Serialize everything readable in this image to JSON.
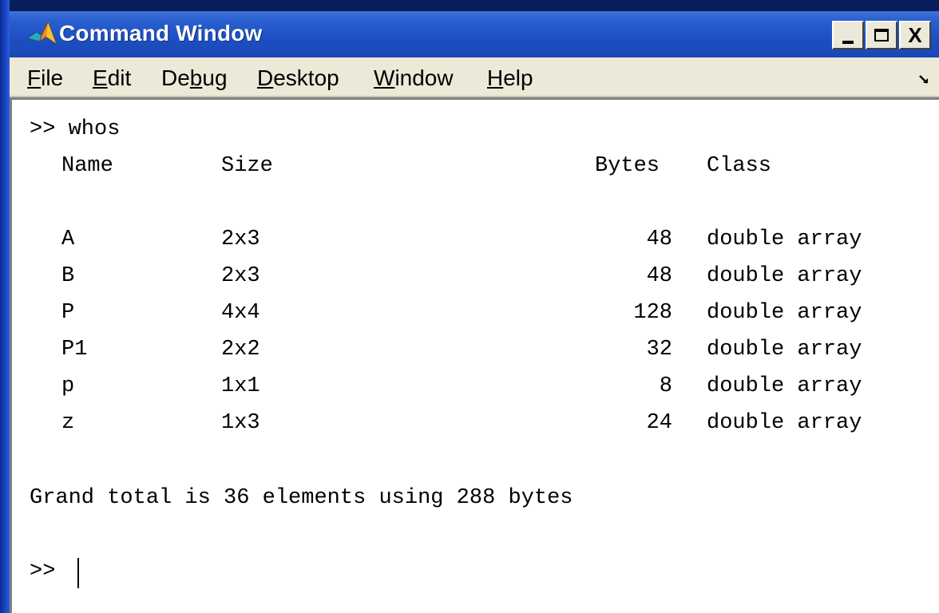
{
  "window": {
    "title": "Command Window",
    "minimize_icon": "minimize-icon",
    "maximize_icon": "maximize-icon",
    "close_label": "X"
  },
  "menu": {
    "items": [
      {
        "label": "File",
        "underline": "F"
      },
      {
        "label": "Edit",
        "underline": "E"
      },
      {
        "label": "Debug",
        "underline": "b"
      },
      {
        "label": "Desktop",
        "underline": "D"
      },
      {
        "label": "Window",
        "underline": "W"
      },
      {
        "label": "Help",
        "underline": "H"
      }
    ]
  },
  "console": {
    "command_line": ">> whos",
    "headers": {
      "name": "Name",
      "size": "Size",
      "bytes": "Bytes",
      "class": "Class"
    },
    "rows": [
      {
        "name": "A",
        "size": "2x3",
        "bytes": "48",
        "class": "double array"
      },
      {
        "name": "B",
        "size": "2x3",
        "bytes": "48",
        "class": "double array"
      },
      {
        "name": "P",
        "size": "4x4",
        "bytes": "128",
        "class": "double array"
      },
      {
        "name": "P1",
        "size": "2x2",
        "bytes": "32",
        "class": "double array"
      },
      {
        "name": "p",
        "size": "1x1",
        "bytes": "8",
        "class": "double array"
      },
      {
        "name": "z",
        "size": "1x3",
        "bytes": "24",
        "class": "double array"
      }
    ],
    "summary": "Grand total is 36 elements using 288 bytes",
    "prompt": ">>"
  },
  "colors": {
    "titlebar": "#1d4fc2",
    "chrome": "#ece9d8",
    "console_bg": "#ffffff",
    "desktop": "#0a1e5c"
  }
}
